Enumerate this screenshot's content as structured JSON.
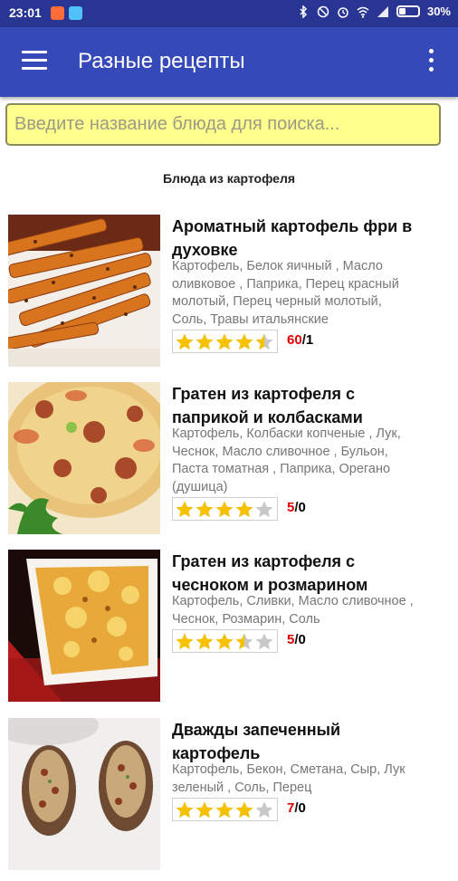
{
  "status_bar": {
    "time": "23:01",
    "battery": "30%"
  },
  "app_bar": {
    "title": "Разные рецепты",
    "menu_icon": "hamburger-menu-icon",
    "overflow_icon": "vertical-dots-icon"
  },
  "search": {
    "placeholder": "Введите название блюда для поиска..."
  },
  "section": {
    "title": "Блюда из картофеля"
  },
  "colors": {
    "status_bar": "#283593",
    "app_bar": "#3649b8",
    "search_bg": "#ffff8d",
    "star": "#f6c200",
    "rating_red": "#e00000"
  },
  "recipes": [
    {
      "title_lines": [
        "Ароматный картофель фри в",
        "духовке"
      ],
      "ingredient_lines": [
        "Картофель, Белок яичный , Масло",
        "оливковое , Паприка, Перец красный",
        "молотый, Перец черный молотый,",
        "Соль, Травы итальянские"
      ],
      "stars": 4.5,
      "votes": "60",
      "comments": "1"
    },
    {
      "title_lines": [
        "Гратен из картофеля с",
        "паприкой и колбасками"
      ],
      "ingredient_lines": [
        "Картофель, Колбаски копченые , Лук,",
        "Чеснок, Масло сливочное , Бульон,",
        "Паста томатная , Паприка, Орегано",
        "(душица)"
      ],
      "stars": 4,
      "votes": "5",
      "comments": "0"
    },
    {
      "title_lines": [
        "Гратен из картофеля с",
        "чесноком и розмарином"
      ],
      "ingredient_lines": [
        "Картофель, Сливки, Масло сливочное ,",
        "Чеснок, Розмарин, Соль"
      ],
      "stars": 3.5,
      "votes": "5",
      "comments": "0"
    },
    {
      "title_lines": [
        "Дважды запеченный",
        "картофель"
      ],
      "ingredient_lines": [
        "Картофель, Бекон, Сметана, Сыр, Лук",
        "зеленый , Соль, Перец"
      ],
      "stars": 4,
      "votes": "7",
      "comments": "0"
    }
  ]
}
